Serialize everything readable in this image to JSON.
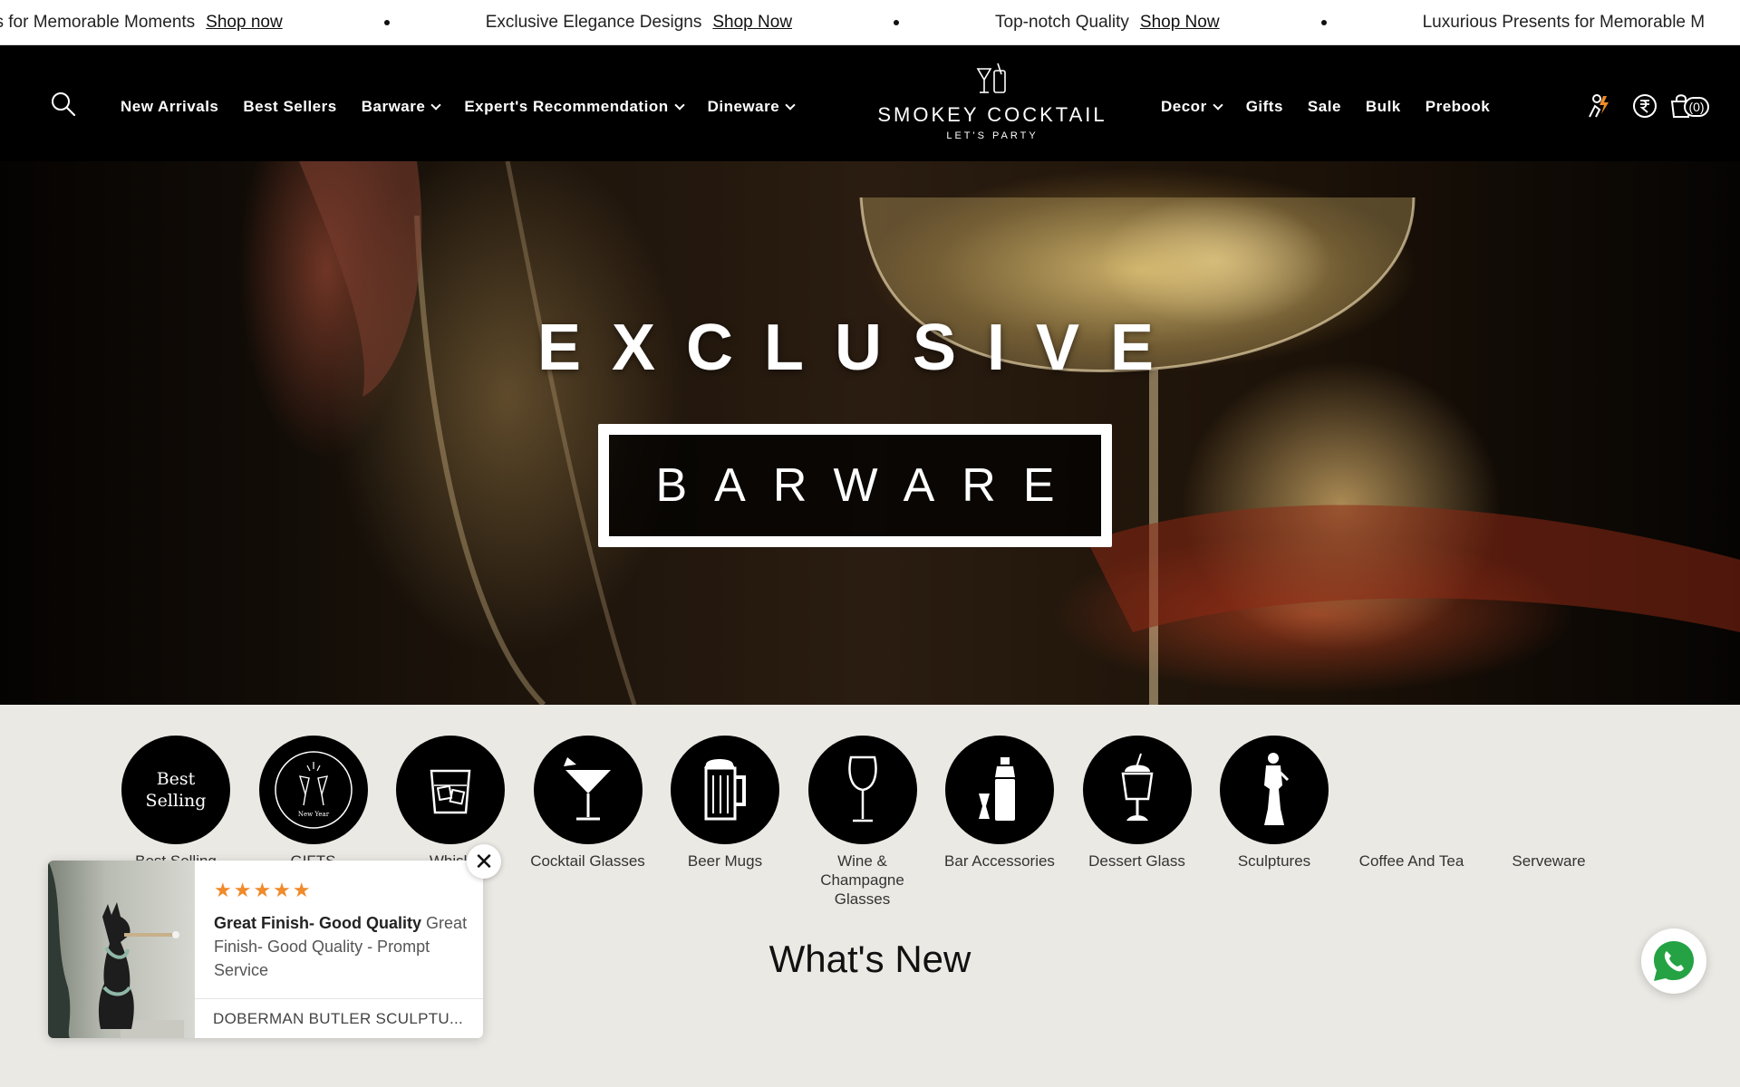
{
  "announcement": {
    "items": [
      {
        "text": "esents for Memorable Moments",
        "link": "Shop now"
      },
      {
        "text": "Exclusive Elegance Designs",
        "link": "Shop Now"
      },
      {
        "text": "Top-notch Quality",
        "link": "Shop Now"
      },
      {
        "text": "Luxurious Presents for Memorable M",
        "link": ""
      }
    ]
  },
  "nav": {
    "left": [
      {
        "label": "New Arrivals",
        "dropdown": false
      },
      {
        "label": "Best Sellers",
        "dropdown": false
      },
      {
        "label": "Barware",
        "dropdown": true
      },
      {
        "label": "Expert's Recommendation",
        "dropdown": true
      },
      {
        "label": "Dineware",
        "dropdown": true
      }
    ],
    "right": [
      {
        "label": "Decor",
        "dropdown": true
      },
      {
        "label": "Gifts",
        "dropdown": false
      },
      {
        "label": "Sale",
        "dropdown": false
      },
      {
        "label": "Bulk",
        "dropdown": false
      },
      {
        "label": "Prebook",
        "dropdown": false
      }
    ]
  },
  "logo": {
    "name": "SMOKEY COCKTAIL",
    "tagline": "LET'S PARTY"
  },
  "header_icons": {
    "search": "search-icon",
    "account": "user-icon",
    "currency": "rupee-icon",
    "cart": "cart-icon"
  },
  "cart": {
    "count": "(0)"
  },
  "hero": {
    "title": "EXCLUSIVE",
    "subtitle": "BARWARE"
  },
  "categories": [
    {
      "label": "Best Selling",
      "icon": "best-selling-text",
      "circle_text": "Best Selling"
    },
    {
      "label": "GIFTS",
      "icon": "new-year-gifts-icon",
      "circle_text": "New Year"
    },
    {
      "label": "Whisk",
      "icon": "whiskey-glass-icon"
    },
    {
      "label": "Cocktail Glasses",
      "icon": "cocktail-glass-icon"
    },
    {
      "label": "Beer Mugs",
      "icon": "beer-mug-icon"
    },
    {
      "label": "Wine & Champagne Glasses",
      "icon": "wine-glass-icon"
    },
    {
      "label": "Bar Accessories",
      "icon": "shaker-icon"
    },
    {
      "label": "Dessert Glass",
      "icon": "dessert-glass-icon"
    },
    {
      "label": "Sculptures",
      "icon": "sculpture-icon"
    },
    {
      "label": "Coffee And Tea",
      "icon": ""
    },
    {
      "label": "Serveware",
      "icon": ""
    }
  ],
  "section": {
    "whats_new": "What's New"
  },
  "review": {
    "stars": "★★★★★",
    "rating": 5,
    "title": "Great Finish- Good Quality",
    "body": "Great Finish- Good Quality - Prompt Service",
    "product": "DOBERMAN BUTLER SCULPTU..."
  },
  "colors": {
    "header_bg": "#000000",
    "page_bg": "#ebe9e4",
    "star": "#f08a2a",
    "whatsapp": "#25a244"
  }
}
